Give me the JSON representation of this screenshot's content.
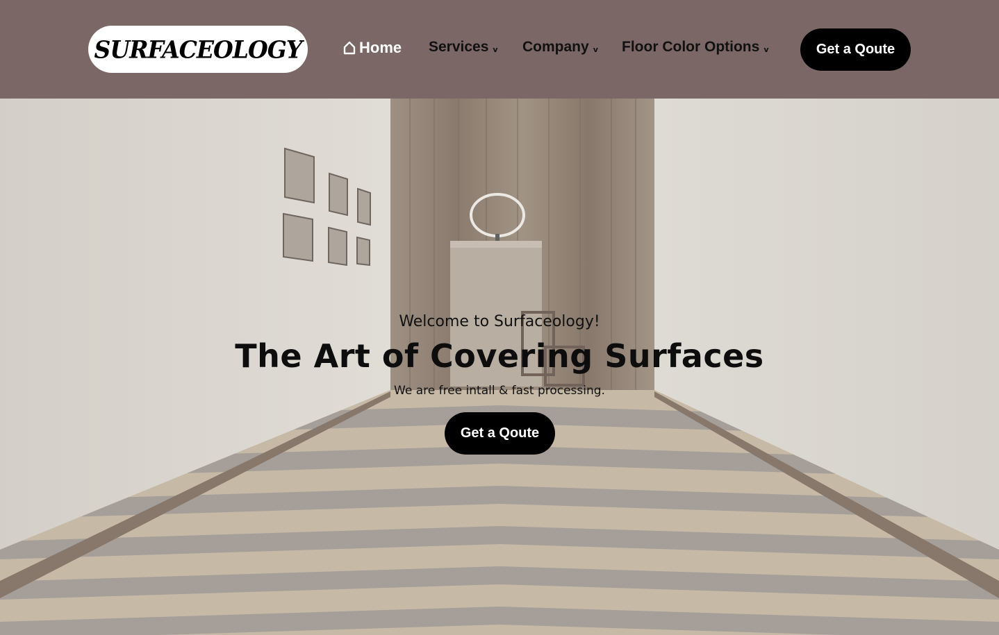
{
  "header": {
    "logo_text": "SURFACEOLOGY",
    "nav": {
      "home": "Home",
      "services": "Services",
      "company": "Company",
      "floor_color_options": "Floor Color Options"
    },
    "quote_button": "Get a Qoute"
  },
  "hero": {
    "welcome": "Welcome to Surfaceology!",
    "headline": "The Art of Covering Surfaces",
    "tagline": "We are free intall &  fast processing.",
    "quote_button": "Get a Qoute"
  },
  "icons": {
    "home": "home-icon",
    "dropdown": "chevron-down-icon"
  },
  "colors": {
    "header_bg": "#7c6767",
    "button_bg": "#000000",
    "button_text": "#ffffff"
  }
}
